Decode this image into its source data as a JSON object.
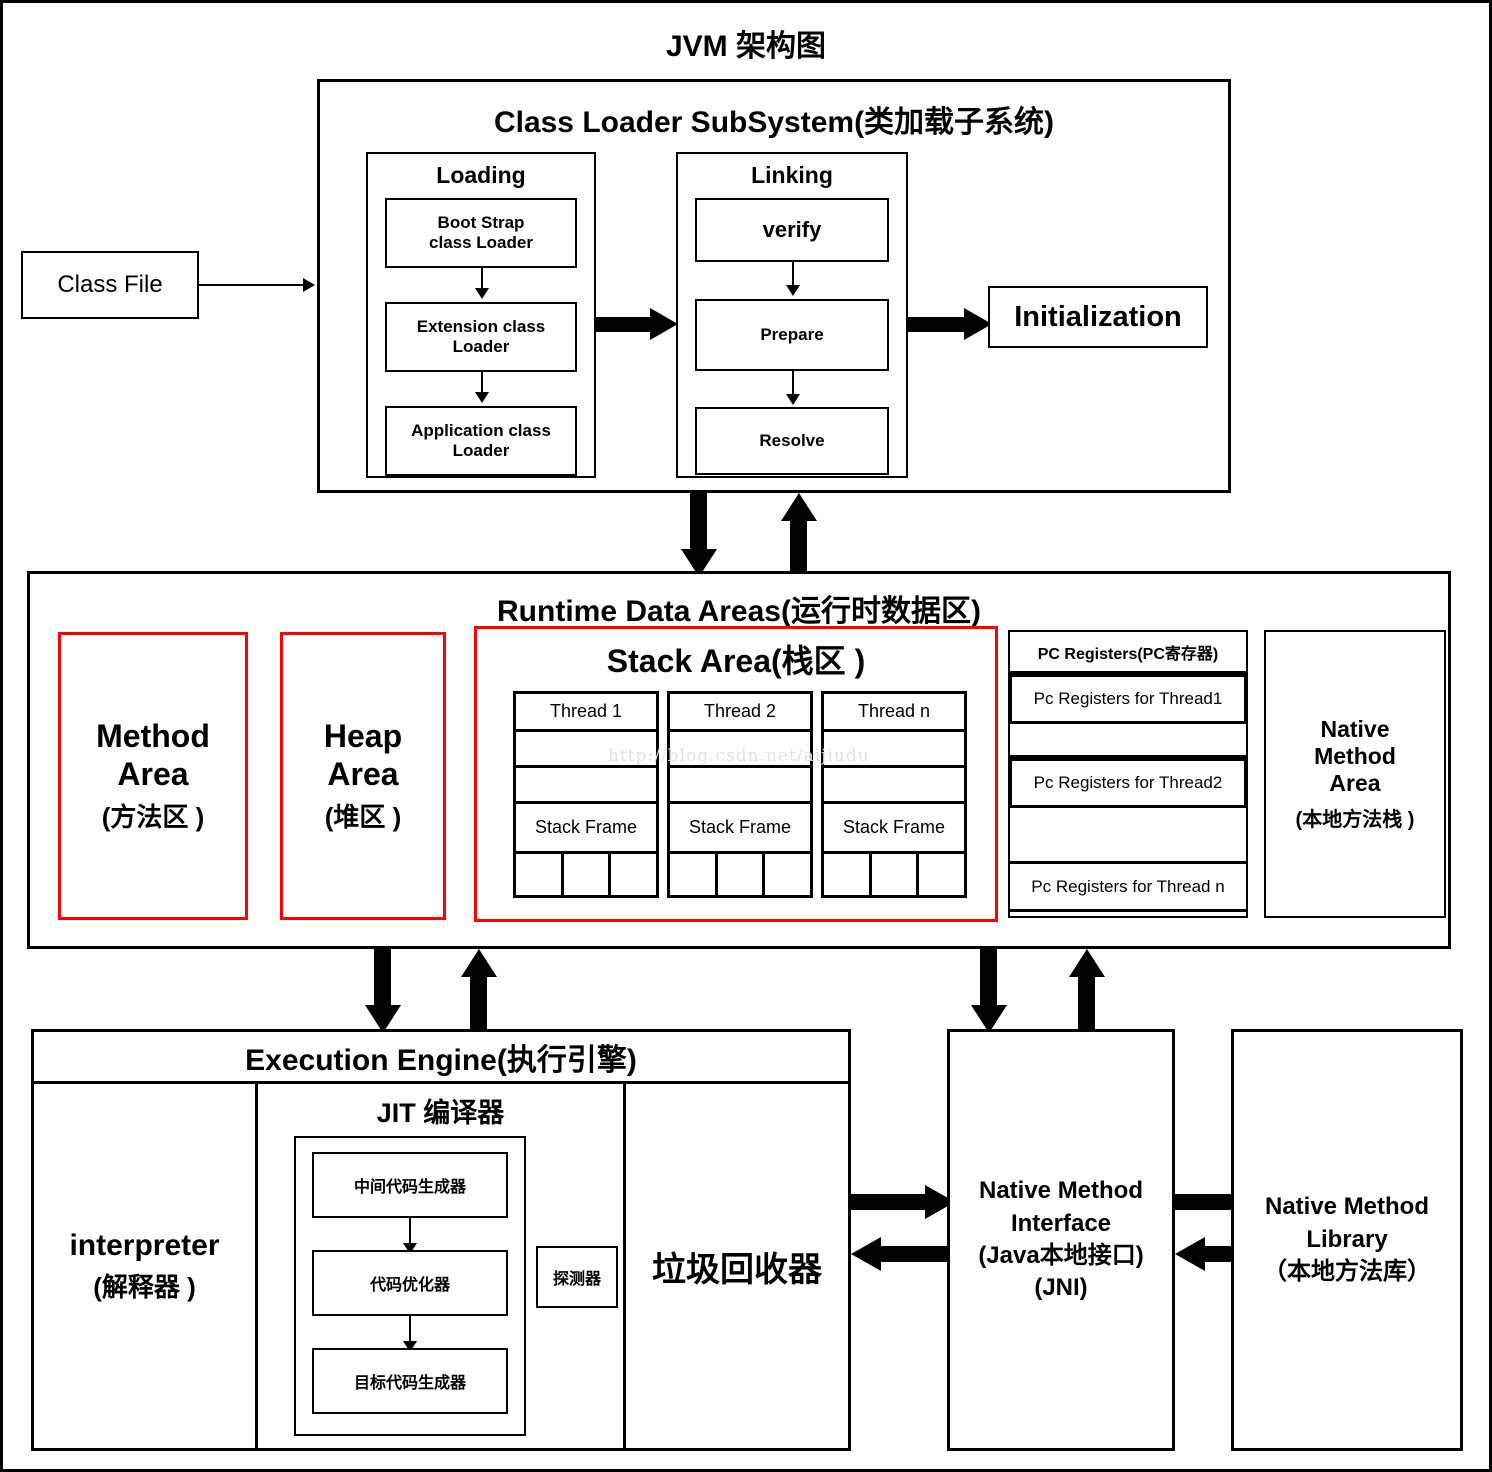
{
  "page": {
    "title": "JVM 架构图",
    "watermark": "http://blog.csdn.net/aijiudu",
    "colors": {
      "ink": "#000000",
      "highlight": "#ff0000",
      "background": "#ffffff"
    }
  },
  "class_file": {
    "label": "Class File"
  },
  "class_loader": {
    "title": "Class Loader SubSystem(类加载子系统)",
    "loading": {
      "title": "Loading",
      "steps": [
        "Boot Strap\nclass Loader",
        "Extension class\nLoader",
        "Application class\nLoader"
      ]
    },
    "linking": {
      "title": "Linking",
      "steps": [
        "verify",
        "Prepare",
        "Resolve"
      ]
    },
    "initialization": {
      "label": "Initialization"
    }
  },
  "runtime_data_areas": {
    "title": "Runtime Data Areas(运行时数据区)",
    "method_area": {
      "en": "Method\nArea",
      "cn": "(方法区 )",
      "highlight": true
    },
    "heap_area": {
      "en": "Heap\nArea",
      "cn": "(堆区 )",
      "highlight": true
    },
    "stack_area": {
      "title": "Stack Area(栈区 )",
      "highlight": true,
      "threads": [
        {
          "name": "Thread 1",
          "frame": "Stack Frame"
        },
        {
          "name": "Thread 2",
          "frame": "Stack Frame"
        },
        {
          "name": "Thread n",
          "frame": "Stack Frame"
        }
      ]
    },
    "pc_registers": {
      "title": "PC Registers(PC寄存器)",
      "rows": [
        "Pc Registers for Thread1",
        "Pc Registers for Thread2",
        "Pc Registers for Thread n"
      ]
    },
    "native_method_area": {
      "en": "Native\nMethod\nArea",
      "cn": "(本地方法栈 )"
    }
  },
  "execution_engine": {
    "title": "Execution Engine(执行引擎)",
    "interpreter": {
      "en": "interpreter",
      "cn": "(解释器 )"
    },
    "jit": {
      "title": "JIT 编译器",
      "steps": [
        "中间代码生成器",
        "代码优化器",
        "目标代码生成器"
      ],
      "profiler": "探测器"
    },
    "garbage_collector": {
      "label": "垃圾回收器"
    }
  },
  "native_method_interface": {
    "line1": "Native Method",
    "line2": "Interface",
    "line3": "(Java本地接口)",
    "line4": "(JNI)"
  },
  "native_method_library": {
    "line1": "Native Method",
    "line2": "Library",
    "line3": "（本地方法库）"
  }
}
